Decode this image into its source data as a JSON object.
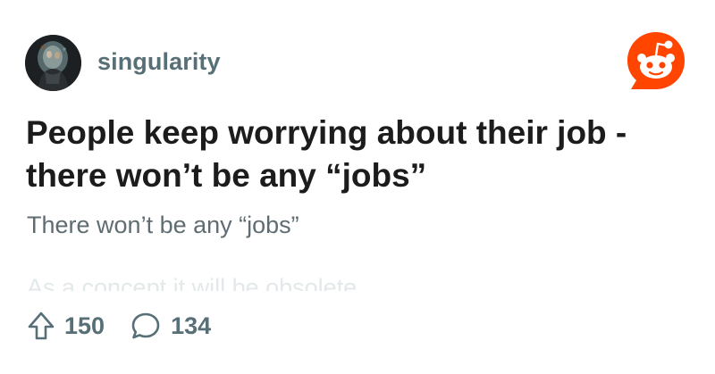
{
  "post": {
    "community": "singularity",
    "title": "People keep worrying about their job - there won’t be any “jobs”",
    "subtitle": "There won’t be any “jobs”",
    "body_preview": "As a concept it will be obsolete"
  },
  "actions": {
    "upvotes": "150",
    "comments": "134"
  },
  "icons": {
    "avatar": "community-avatar",
    "logo": "reddit-logo-icon",
    "upvote": "upvote-arrow-icon",
    "comment": "comment-bubble-icon"
  },
  "colors": {
    "brand": "#ff4500",
    "title": "#1c1c1c",
    "meta": "#576f76",
    "subtitle": "#5f6d72",
    "faded": "#e3e8ea"
  }
}
